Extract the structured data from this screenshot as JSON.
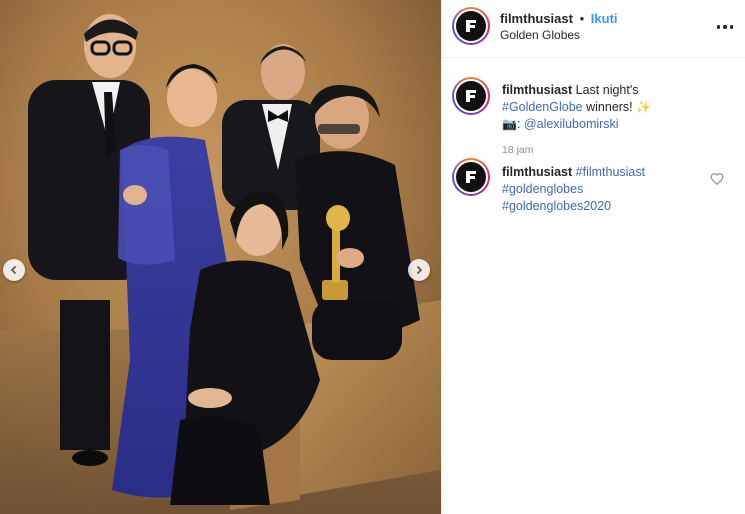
{
  "post": {
    "username": "filmthusiast",
    "separator": "•",
    "follow_label": "Ikuti",
    "location": "Golden Globes",
    "more_icon": "more-horizontal-icon"
  },
  "caption": {
    "username": "filmthusiast",
    "text_intro": "Last night's",
    "hashtag1": "#GoldenGlobe",
    "text_mid": "winners!",
    "emoji_sparkle": "✨",
    "emoji_camera": "📷",
    "colon": ":",
    "mention": "@alexilubomirski",
    "timestamp": "18 jam"
  },
  "comment": {
    "username": "filmthusiast",
    "hashtags": [
      "#filmthusiast",
      "#goldenglobes",
      "#goldenglobes2020"
    ]
  },
  "colors": {
    "link": "#3897f0",
    "hashtag": "#3f6ab5",
    "muted": "#8e8e8e",
    "text": "#262626"
  }
}
